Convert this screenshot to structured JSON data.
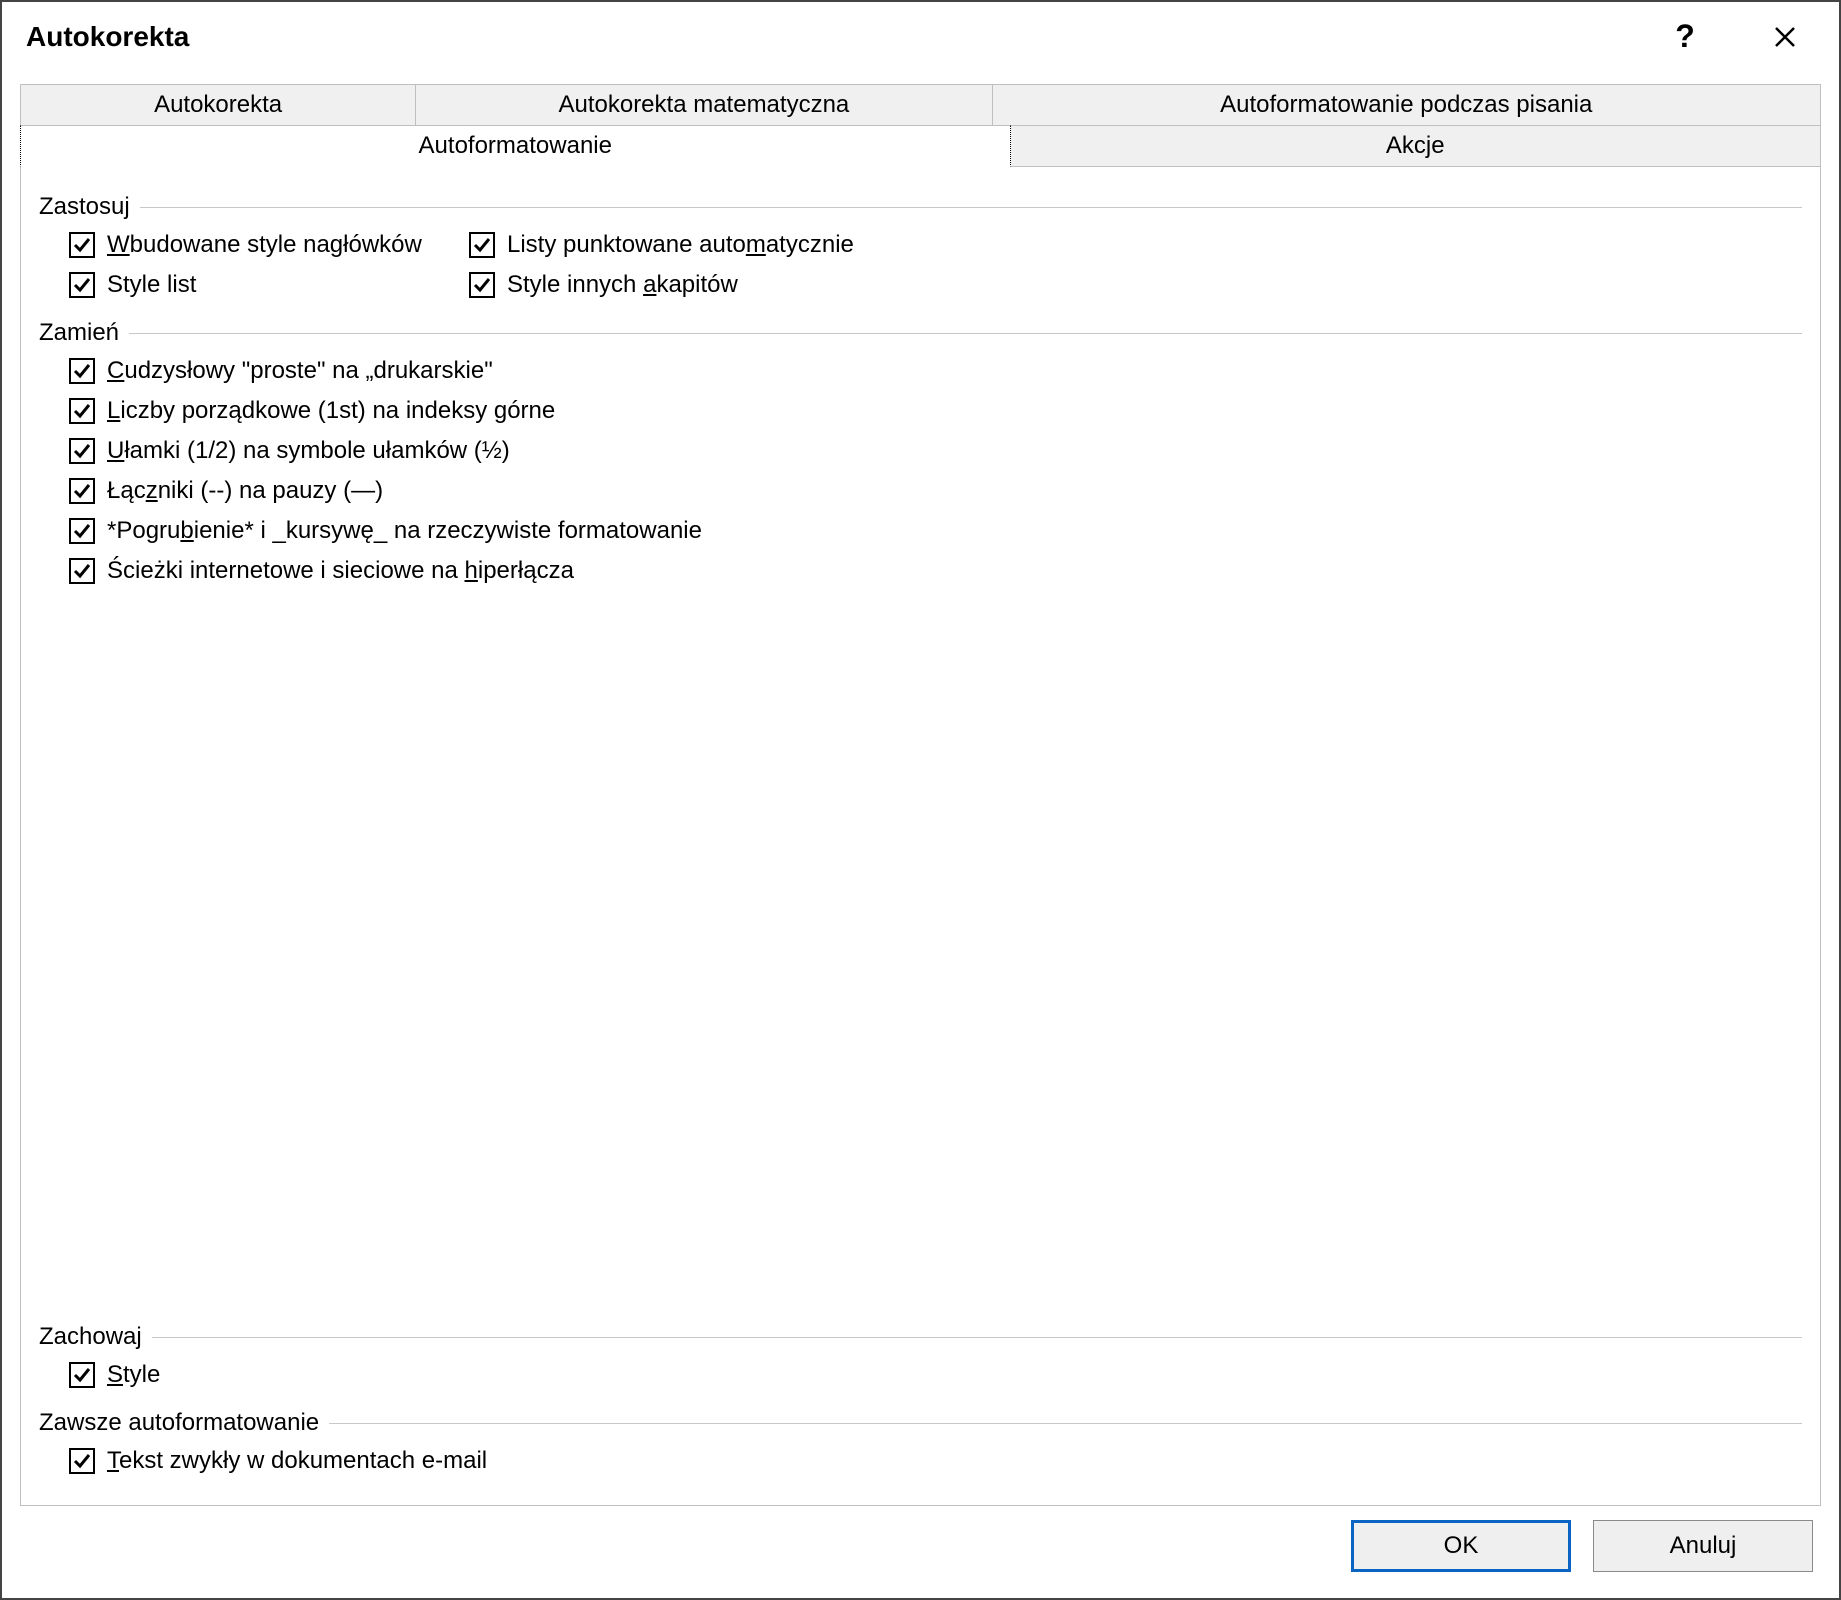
{
  "window": {
    "title": "Autokorekta"
  },
  "tabs": {
    "row1": [
      {
        "label": "Autokorekta"
      },
      {
        "label": "Autokorekta matematyczna"
      },
      {
        "label": "Autoformatowanie podczas pisania"
      }
    ],
    "row2": [
      {
        "label": "Autoformatowanie",
        "active": true
      },
      {
        "label": "Akcje"
      }
    ]
  },
  "groups": {
    "zastosuj": {
      "title": "Zastosuj",
      "items": [
        {
          "checked": true,
          "parts": [
            {
              "text": "W",
              "underline": true
            },
            {
              "text": "budowane style nagłówków"
            }
          ]
        },
        {
          "checked": true,
          "parts": [
            {
              "text": "Listy punktowane auto"
            },
            {
              "text": "m",
              "underline": true
            },
            {
              "text": "atycznie"
            }
          ]
        },
        {
          "checked": true,
          "parts": [
            {
              "text": "Style list"
            }
          ]
        },
        {
          "checked": true,
          "parts": [
            {
              "text": "Style innych "
            },
            {
              "text": "a",
              "underline": true
            },
            {
              "text": "kapitów"
            }
          ]
        }
      ]
    },
    "zamien": {
      "title": "Zamień",
      "items": [
        {
          "checked": true,
          "parts": [
            {
              "text": "C",
              "underline": true
            },
            {
              "text": "udzysłowy \"proste\" na „drukarskie\""
            }
          ]
        },
        {
          "checked": true,
          "parts": [
            {
              "text": "L",
              "underline": true
            },
            {
              "text": "iczby porządkowe (1st) na indeksy górne"
            }
          ]
        },
        {
          "checked": true,
          "parts": [
            {
              "text": "U",
              "underline": true
            },
            {
              "text": "łamki (1/2) na symbole ułamków (½)"
            }
          ]
        },
        {
          "checked": true,
          "parts": [
            {
              "text": "Łąc"
            },
            {
              "text": "z",
              "underline": true
            },
            {
              "text": "niki (--) na pauzy (—)"
            }
          ]
        },
        {
          "checked": true,
          "parts": [
            {
              "text": "*Pogru"
            },
            {
              "text": "b",
              "underline": true
            },
            {
              "text": "ienie* i _kursywę_ na rzeczywiste formatowanie"
            }
          ]
        },
        {
          "checked": true,
          "parts": [
            {
              "text": "Ścieżki internetowe i sieciowe na "
            },
            {
              "text": "h",
              "underline": true
            },
            {
              "text": "iperłącza"
            }
          ]
        }
      ]
    },
    "zachowaj": {
      "title": "Zachowaj",
      "items": [
        {
          "checked": true,
          "parts": [
            {
              "text": "S",
              "underline": true
            },
            {
              "text": "tyle"
            }
          ]
        }
      ]
    },
    "zawsze": {
      "title": "Zawsze autoformatowanie",
      "items": [
        {
          "checked": true,
          "parts": [
            {
              "text": "T",
              "underline": true
            },
            {
              "text": "ekst zwykły w dokumentach e-mail"
            }
          ]
        }
      ]
    }
  },
  "buttons": {
    "ok": "OK",
    "cancel": "Anuluj"
  }
}
